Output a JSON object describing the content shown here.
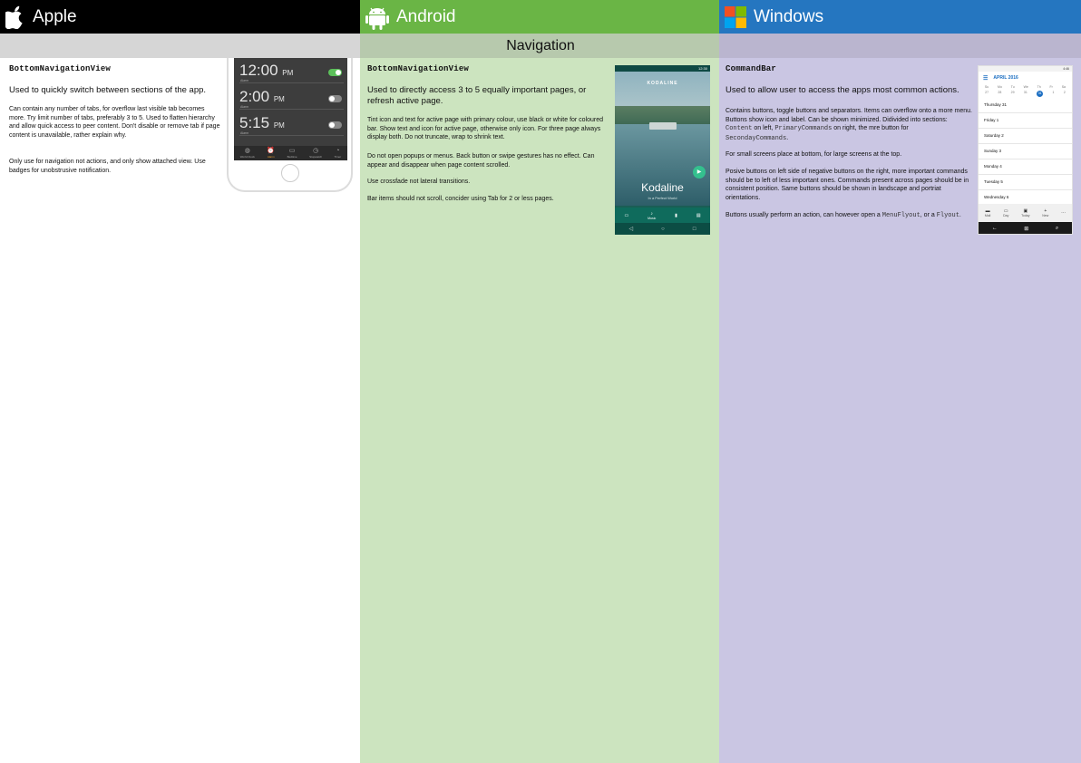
{
  "header": {
    "apple": "Apple",
    "android": "Android",
    "windows": "Windows"
  },
  "section_title": "Navigation",
  "apple": {
    "class_name": "BottomNavigationView",
    "lead": "Used to quickly switch between sections of the app.",
    "p1": "Can contain any number of tabs, for overflow last visible tab becomes more. Try limit number of tabs, preferably 3 to 5. Used to flatten hierarchy and allow quick access to peer content. Don't disable or remove tab if page content is unavailable, rather explain why.",
    "p2": "Only use for navigation not actions, and only show attached view. Use badges for unobstrusive notification.",
    "mockup": {
      "alarms": [
        {
          "time": "12:00",
          "ampm": "PM",
          "label": "Alarm",
          "on": true
        },
        {
          "time": "2:00",
          "ampm": "PM",
          "label": "Alarm",
          "on": false
        },
        {
          "time": "5:15",
          "ampm": "PM",
          "label": "Alarm",
          "on": false
        }
      ],
      "tabs": [
        {
          "icon": "globe-icon",
          "glyph": "◍",
          "label": "World Clock"
        },
        {
          "icon": "alarm-icon",
          "glyph": "⏰",
          "label": "Alarm",
          "active": true
        },
        {
          "icon": "bed-icon",
          "glyph": "▭",
          "label": "Bedtime"
        },
        {
          "icon": "stopwatch-icon",
          "glyph": "◷",
          "label": "Stopwatch"
        },
        {
          "icon": "timer-icon",
          "glyph": "◔",
          "label": "Timer"
        }
      ]
    }
  },
  "android": {
    "class_name": "BottomNavigationView",
    "lead": "Used to directly access 3 to 5 equally important pages, or refresh active page.",
    "p1": "Tint icon and text for active page with primary colour, use black or white for coloured bar. Show text and icon for active page, otherwise only icon. For three page always display both. Do not truncate, wrap to shrink text.",
    "p2": "Do not open popups or menus. Back button or swipe gestures has no effect. Can appear and disappear when page content scrolled.",
    "p3": "Use crossfade not lateral transitions.",
    "p4": "Bar items should not scroll, concider using Tab for 2 or less pages.",
    "mockup": {
      "status_time": "12:30",
      "band": "KODALINE",
      "album": "Kodaline",
      "album_sub": "In a Perfect World",
      "tabs": [
        {
          "icon": "tv-icon",
          "glyph": "▭",
          "label": ""
        },
        {
          "icon": "music-icon",
          "glyph": "♪",
          "label": "Music"
        },
        {
          "icon": "book-icon",
          "glyph": "▮",
          "label": ""
        },
        {
          "icon": "newsstand-icon",
          "glyph": "▤",
          "label": ""
        }
      ],
      "sysnav": [
        "◁",
        "○",
        "□"
      ]
    }
  },
  "windows": {
    "class_name": "CommandBar",
    "lead": "Used to allow user to access the apps most common actions.",
    "p1_a": "Contains buttons, toggle buttons and separators. Items can overflow onto a more menu. Buttons show icon and label. Can be shown minimized. Didivided into sections: ",
    "code_content": "Content",
    "p1_b": " on left, ",
    "code_primary": "PrimaryCommands",
    "p1_c": " on right, the mre button for ",
    "code_secondary": "SecondayCommands",
    "p1_d": ".",
    "p2": "For small screens place at bottom, for large screens at the top.",
    "p3": "Posive buttons on left side of negative buttons on the right, more important commands should be to left of less important ones. Commands present across pages should be in consistent position. Same buttons should be shown in landscape and portriat orientations.",
    "p4_a": "Buttons usually perform an action, can however open a ",
    "code_menuflyout": "MenuFlyout",
    "p4_b": ", or a ",
    "code_flyout": "Flyout",
    "p4_c": ".",
    "mockup": {
      "status_time": "4:46",
      "month": "APRIL 2016",
      "dow": [
        "Su",
        "Mo",
        "Tu",
        "We",
        "Th",
        "Fr",
        "Sa"
      ],
      "dates": [
        "27",
        "28",
        "29",
        "31",
        "31",
        "1",
        "2"
      ],
      "days": [
        "Thursday 31",
        "Friday 1",
        "Saturday 2",
        "Sunday 3",
        "Monday 4",
        "Tuesday 5",
        "Wednesday 6"
      ],
      "commands": [
        {
          "icon": "mail-icon",
          "glyph": "▬",
          "label": "Mail"
        },
        {
          "icon": "day-icon",
          "glyph": "▭",
          "label": "Day"
        },
        {
          "icon": "today-icon",
          "glyph": "▣",
          "label": "Today"
        },
        {
          "icon": "add-icon",
          "glyph": "+",
          "label": "New"
        },
        {
          "icon": "more-icon",
          "glyph": "···",
          "label": ""
        }
      ],
      "sysnav": [
        "←",
        "⊞",
        "⌕"
      ]
    }
  },
  "colors": {
    "apple_header": "#000000",
    "android_header": "#6ab545",
    "windows_header": "#2576c0",
    "android_body": "#cce4bf",
    "windows_body": "#cac6e3"
  }
}
